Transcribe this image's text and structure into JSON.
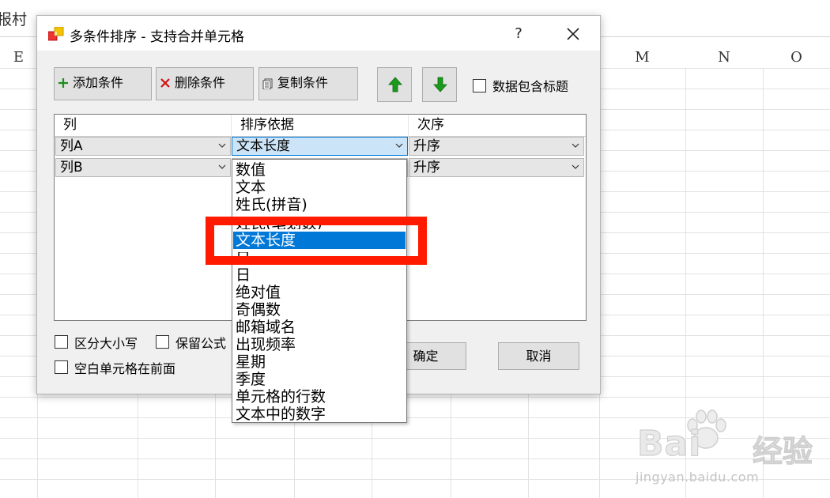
{
  "sheet": {
    "cell_ref": "报村",
    "columns": [
      "E",
      "M",
      "N",
      "O"
    ]
  },
  "dialog": {
    "title": "多条件排序 - 支持合并单元格",
    "help": "?",
    "toolbar": {
      "add": "添加条件",
      "delete": "删除条件",
      "copy": "复制条件",
      "has_header": "数据包含标题"
    },
    "grid": {
      "headers": [
        "列",
        "排序依据",
        "次序"
      ],
      "rows": [
        {
          "column": "列A",
          "basis": "文本长度",
          "order": "升序"
        },
        {
          "column": "列B",
          "basis": "",
          "order": "升序"
        }
      ]
    },
    "options": {
      "case_sensitive": "区分大小写",
      "keep_formula": "保留公式",
      "blank_first": "空白单元格在前面"
    },
    "ok": "确定",
    "cancel": "取消"
  },
  "dropdown": {
    "options": [
      "数值",
      "文本",
      "姓氏(拼音)",
      "姓氏(笔划数)",
      "文本长度",
      "日",
      "日",
      "绝对值",
      "奇偶数",
      "邮箱域名",
      "出现频率",
      "星期",
      "季度",
      "单元格的行数",
      "文本中的数字"
    ],
    "selected": "文本长度"
  },
  "watermark": {
    "logo": "Bai",
    "text": "经验",
    "url": "jingyan.baidu.com"
  },
  "colors": {
    "selection": "#0078d7",
    "highlight_box": "#ff1a00",
    "dialog_bg": "#f0f0f0",
    "add_icon": "#1a8f1a",
    "delete_icon": "#d01010",
    "arrow_green": "#1a9a1a"
  }
}
